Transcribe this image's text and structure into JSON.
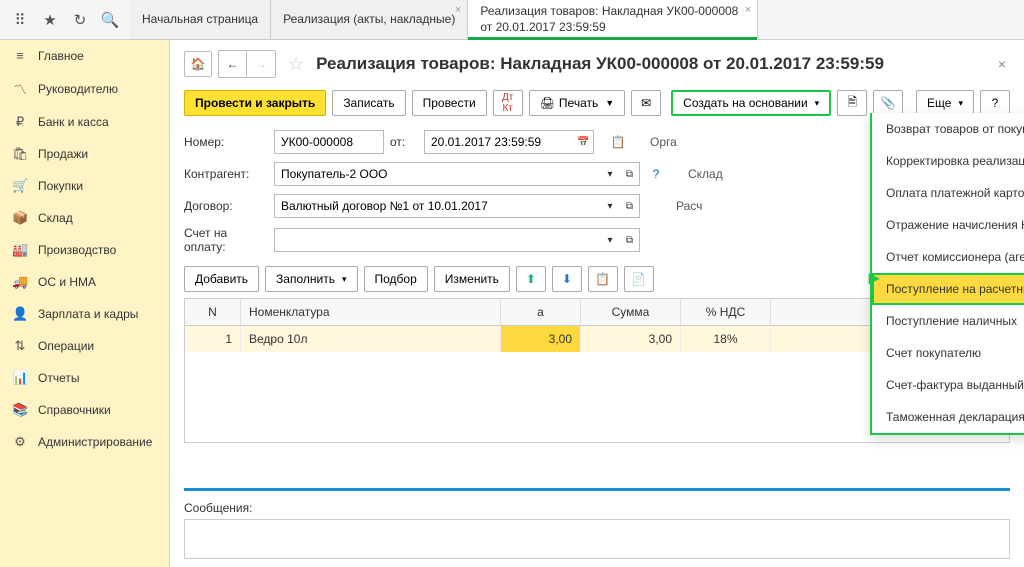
{
  "tabs": [
    {
      "label": "Начальная страница"
    },
    {
      "label": "Реализация (акты, накладные)"
    },
    {
      "label": "Реализация товаров: Накладная УК00-000008 от 20.01.2017 23:59:59"
    }
  ],
  "sidebar": [
    {
      "icon": "≡",
      "label": "Главное"
    },
    {
      "icon": "〽",
      "label": "Руководителю"
    },
    {
      "icon": "₽",
      "label": "Банк и касса"
    },
    {
      "icon": "🛍",
      "label": "Продажи"
    },
    {
      "icon": "🛒",
      "label": "Покупки"
    },
    {
      "icon": "📦",
      "label": "Склад"
    },
    {
      "icon": "🏭",
      "label": "Производство"
    },
    {
      "icon": "🚚",
      "label": "ОС и НМА"
    },
    {
      "icon": "👤",
      "label": "Зарплата и кадры"
    },
    {
      "icon": "⇅",
      "label": "Операции"
    },
    {
      "icon": "📊",
      "label": "Отчеты"
    },
    {
      "icon": "📚",
      "label": "Справочники"
    },
    {
      "icon": "⚙",
      "label": "Администрирование"
    }
  ],
  "page": {
    "title": "Реализация товаров: Накладная УК00-000008 от 20.01.2017 23:59:59"
  },
  "toolbar": {
    "post_close": "Провести и закрыть",
    "save": "Записать",
    "post": "Провести",
    "print": "Печать",
    "create_based": "Создать на основании",
    "more": "Еще",
    "help": "?"
  },
  "dropdown": [
    "Возврат товаров от покупателя",
    "Корректировка реализации",
    "Оплата платежной картой",
    "Отражение начисления НДС",
    "Отчет комиссионера (агента) о продажах",
    "Поступление на расчетный счет",
    "Поступление наличных",
    "Счет покупателю",
    "Счет-фактура выданный",
    "Таможенная декларация (экспорт)"
  ],
  "form": {
    "number_label": "Номер:",
    "number": "УК00-000008",
    "from_label": "от:",
    "date": "20.01.2017 23:59:59",
    "org_label": "Орга",
    "counterparty_label": "Контрагент:",
    "counterparty": "Покупатель-2 ООО",
    "warehouse_label": "Склад",
    "contract_label": "Договор:",
    "contract": "Валютный договор №1 от 10.01.2017",
    "calc_label": "Расч",
    "invoice_label": "Счет на оплату:"
  },
  "table_toolbar": {
    "add": "Добавить",
    "fill": "Заполнить",
    "pick": "Подбор",
    "edit": "Изменить"
  },
  "table": {
    "headers": {
      "n": "N",
      "name": "Номенклатура",
      "a": "а",
      "sum": "Сумма",
      "vat": "% НДС"
    },
    "rows": [
      {
        "n": "1",
        "name": "Ведро 10л",
        "a": "3,00",
        "sum": "3,00",
        "vat": "18%"
      }
    ]
  },
  "messages_label": "Сообщения:"
}
